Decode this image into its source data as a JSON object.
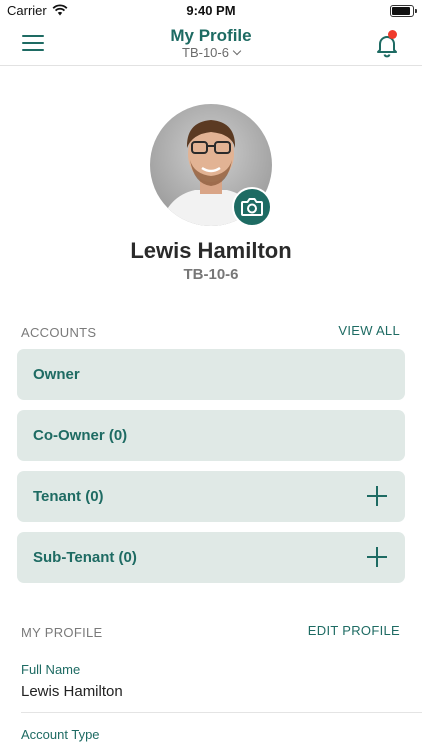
{
  "status_bar": {
    "carrier": "Carrier",
    "time": "9:40 PM"
  },
  "header": {
    "title": "My Profile",
    "unit": "TB-10-6",
    "has_notification": true
  },
  "profile": {
    "name": "Lewis Hamilton",
    "unit": "TB-10-6"
  },
  "accounts": {
    "heading": "ACCOUNTS",
    "view_all": "VIEW ALL",
    "items": [
      {
        "label": "Owner",
        "addable": false
      },
      {
        "label": "Co-Owner (0)",
        "addable": false
      },
      {
        "label": "Tenant (0)",
        "addable": true
      },
      {
        "label": "Sub-Tenant (0)",
        "addable": true
      }
    ]
  },
  "my_profile": {
    "heading": "MY PROFILE",
    "edit": "EDIT PROFILE",
    "fields": [
      {
        "label": "Full Name",
        "value": "Lewis Hamilton"
      },
      {
        "label": "Account Type",
        "value": ""
      }
    ]
  },
  "colors": {
    "accent": "#1e6b63",
    "card_bg": "#e0e9e6",
    "notification_dot": "#ef3b2c"
  },
  "icons": [
    "menu-icon",
    "chevron-down-icon",
    "bell-icon",
    "camera-icon",
    "plus-icon",
    "wifi-icon",
    "battery-icon"
  ]
}
